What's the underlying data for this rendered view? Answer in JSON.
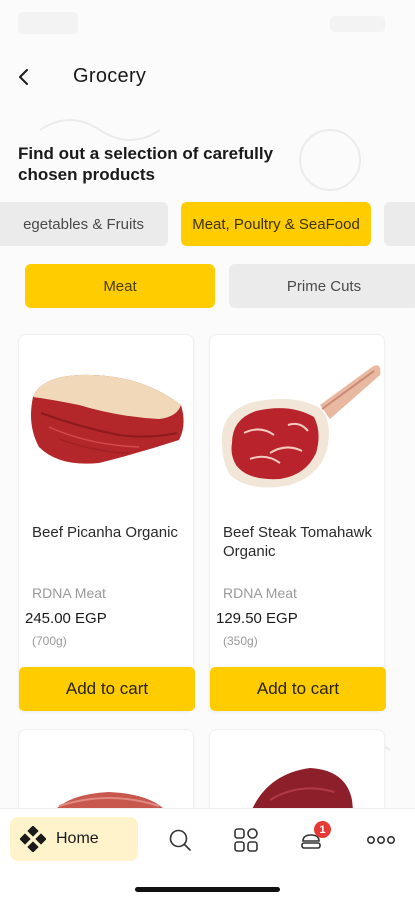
{
  "header": {
    "title": "Grocery",
    "back_icon": "chevron-left-icon"
  },
  "intro": {
    "text": "Find out a selection of carefully chosen products"
  },
  "categories": [
    {
      "label": "egetables & Fruits",
      "selected": false
    },
    {
      "label": "Meat, Poultry & SeaFood",
      "selected": true
    },
    {
      "label": "",
      "selected": false
    }
  ],
  "subcategories": [
    {
      "label": "Meat",
      "selected": true
    },
    {
      "label": "Prime Cuts",
      "selected": false
    }
  ],
  "products": [
    {
      "name": "Beef Picanha Organic",
      "brand": "RDNA Meat",
      "price": "245.00 EGP",
      "weight": "(700g)",
      "add_label": "Add to cart"
    },
    {
      "name": "Beef Steak Tomahawk Organic",
      "brand": "RDNA Meat",
      "price": "129.50 EGP",
      "weight": "(350g)",
      "add_label": "Add to cart"
    }
  ],
  "nav": {
    "home_label": "Home",
    "cart_count": "1",
    "icons": [
      "home-icon",
      "search-icon",
      "categories-icon",
      "cart-icon",
      "more-icon"
    ]
  },
  "colors": {
    "accent": "#ffcc00",
    "accent_soft": "#fff3cc",
    "chip_grey": "#ebebeb",
    "badge": "#e53935"
  }
}
